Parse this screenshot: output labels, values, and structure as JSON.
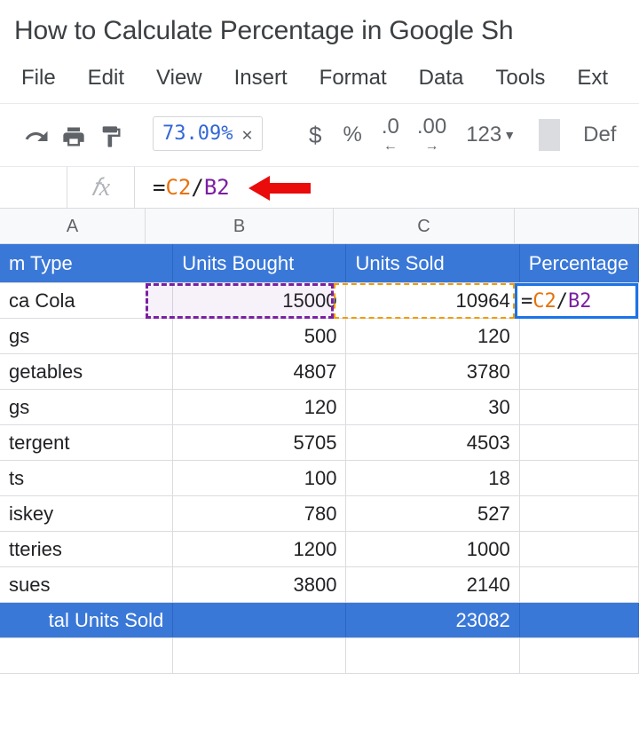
{
  "title": "How to Calculate Percentage in Google Sh",
  "menus": {
    "file": "File",
    "edit": "Edit",
    "view": "View",
    "insert": "Insert",
    "format": "Format",
    "data": "Data",
    "tools": "Tools",
    "extensions": "Ext"
  },
  "tooltip_result": "73.09%",
  "format_buttons": {
    "currency": "$",
    "percent": "%",
    "dec_dec": ".0",
    "inc_dec": ".00",
    "more": "123",
    "font_trunc": "Def"
  },
  "formula": {
    "eq": "=",
    "ref1": "C2",
    "slash": "/",
    "ref2": "B2"
  },
  "col_labels": {
    "a": "A",
    "b": "B",
    "c": "C"
  },
  "headers": {
    "a": "m Type",
    "b": "Units Bought",
    "c": "Units Sold",
    "d": "Percentage"
  },
  "rows": [
    {
      "a": "ca Cola",
      "b": "15000",
      "c": "10964"
    },
    {
      "a": "gs",
      "b": "500",
      "c": "120"
    },
    {
      "a": "getables",
      "b": "4807",
      "c": "3780"
    },
    {
      "a": "gs",
      "b": "120",
      "c": "30"
    },
    {
      "a": "tergent",
      "b": "5705",
      "c": "4503"
    },
    {
      "a": "ts",
      "b": "100",
      "c": "18"
    },
    {
      "a": "iskey",
      "b": "780",
      "c": "527"
    },
    {
      "a": "tteries",
      "b": "1200",
      "c": "1000"
    },
    {
      "a": "sues",
      "b": "3800",
      "c": "2140"
    }
  ],
  "total_row": {
    "a": "tal Units Sold",
    "b": "",
    "c": "23082"
  },
  "active_cell_display": {
    "eq": "=",
    "ref1": "C2",
    "slash": "/",
    "ref2": "B2"
  },
  "chart_data": {
    "type": "table",
    "title": "How to Calculate Percentage in Google Sheets (cropped)",
    "columns": [
      "Item Type (cropped)",
      "Units Bought",
      "Units Sold",
      "Percentage Sold (formula)"
    ],
    "rows": [
      [
        "...ca Cola",
        15000,
        10964,
        "=C2/B2"
      ],
      [
        "...gs",
        500,
        120,
        null
      ],
      [
        "...getables",
        4807,
        3780,
        null
      ],
      [
        "...gs",
        120,
        30,
        null
      ],
      [
        "...tergent",
        5705,
        4503,
        null
      ],
      [
        "...ts",
        100,
        18,
        null
      ],
      [
        "...iskey",
        780,
        527,
        null
      ],
      [
        "...tteries",
        1200,
        1000,
        null
      ],
      [
        "...sues",
        3800,
        2140,
        null
      ]
    ],
    "totals": {
      "label": "...tal Units Sold",
      "units_sold": 23082
    },
    "formula_result_preview": "73.09%"
  }
}
